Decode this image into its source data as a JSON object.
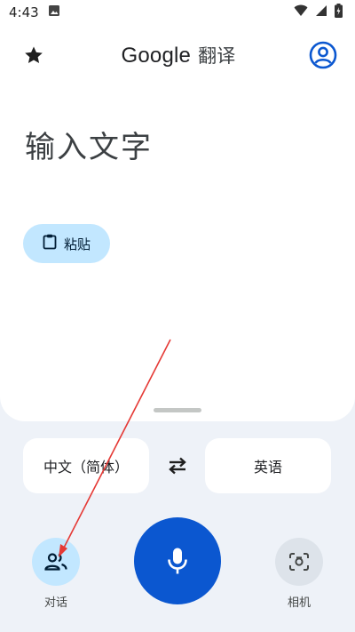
{
  "status_bar": {
    "time": "4:43",
    "icons": [
      "image-icon",
      "wifi-icon",
      "signal-icon",
      "battery-charging-icon"
    ]
  },
  "app_bar": {
    "title_brand": "Google",
    "title_suffix": "翻译",
    "left_icon": "star-icon",
    "right_icon": "account-icon"
  },
  "input": {
    "placeholder": "输入文字"
  },
  "paste": {
    "label": "粘贴",
    "icon": "clipboard-icon"
  },
  "languages": {
    "source": "中文（简体）",
    "target": "英语",
    "swap_icon": "swap-arrows-icon"
  },
  "bottom_actions": {
    "conversation_label": "对话",
    "camera_label": "相机",
    "mic_icon": "microphone-icon"
  },
  "colors": {
    "accent": "#0b57d0",
    "chip": "#c2e7ff",
    "annotation_arrow": "#e53935"
  }
}
